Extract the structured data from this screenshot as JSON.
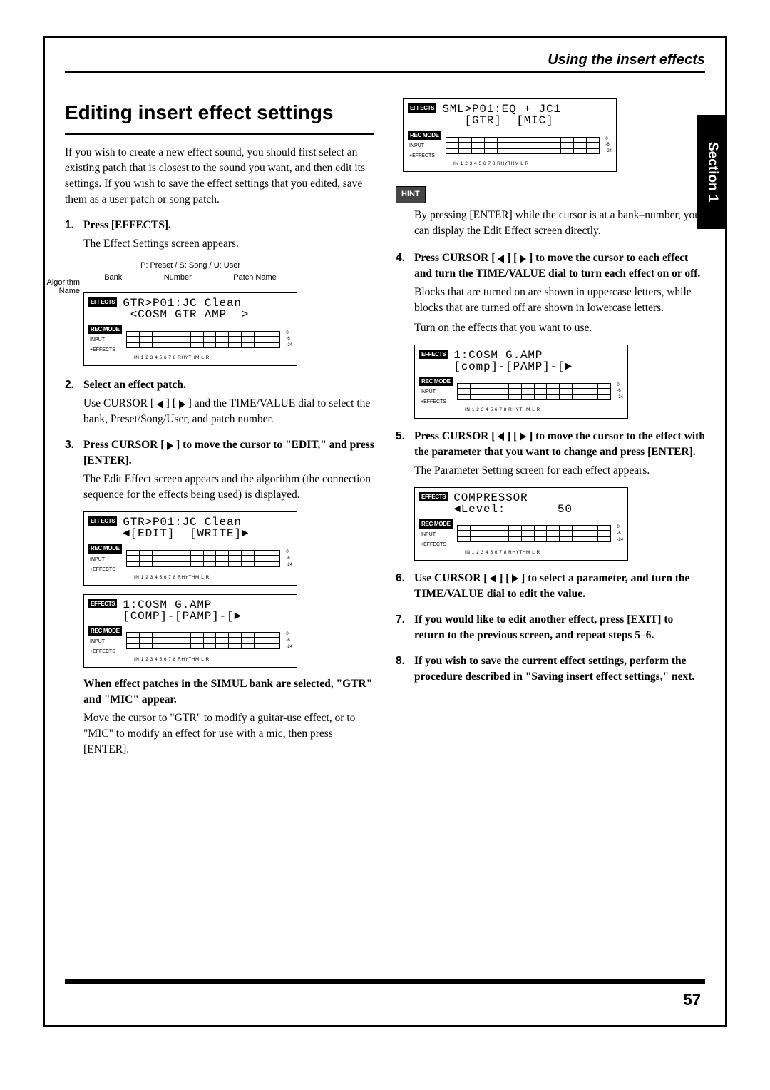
{
  "running_head": "Using the insert effects",
  "side_tab": "Section 1",
  "page_number": "57",
  "h1": "Editing insert effect settings",
  "intro": "If you wish to create a new effect sound, you should first select an existing patch that is closest to the sound you want, and then edit its settings. If you wish to save the effect settings that you edited, save them as a user patch or song patch.",
  "step1": {
    "num": "1.",
    "head": "Press [EFFECTS].",
    "body": "The Effect Settings screen appears."
  },
  "annot": {
    "topline": "P: Preset / S: Song / U: User",
    "algorithm": "Algorithm\nName",
    "bank": "Bank",
    "number": "Number",
    "patch": "Patch Name"
  },
  "lcd1": {
    "line1": "GTR>P01:JC Clean",
    "line2": " <COSM GTR AMP  >",
    "effects": "EFFECTS",
    "recmode": "REC MODE",
    "input": "INPUT",
    "plus": "+EFFECTS",
    "scale0": "0",
    "scale6": "-6",
    "scale24": "-24",
    "footer": "IN      1  2  3  4  5  6  7  8  RHYTHM      L   R"
  },
  "step2": {
    "num": "2.",
    "head": "Select an effect patch.",
    "body": "Use CURSOR [ ◁ ] [ ▷ ] and the TIME/VALUE dial to select the bank, Preset/Song/User, and patch number."
  },
  "step3": {
    "num": "3.",
    "head": "Press CURSOR [ ▷ ] to move the cursor to \"EDIT,\" and press [ENTER].",
    "body": "The Edit Effect screen appears and the algorithm (the connection sequence for the effects being used) is displayed."
  },
  "lcd2": {
    "line1": "GTR>P01:JC Clean",
    "line2": "◄[EDIT]  [WRITE]►"
  },
  "lcd3": {
    "line1": "1:COSM G.AMP",
    "line2": "[COMP]-[PAMP]-[►"
  },
  "simul_head": "When effect patches in the SIMUL bank are selected, \"GTR\" and \"MIC\" appear.",
  "simul_body": "Move the cursor to \"GTR\" to modify a guitar-use effect, or to \"MIC\" to modify an effect for use with a mic, then press [ENTER].",
  "lcd4": {
    "line1": "SML>P01:EQ + JC1",
    "line2": "   [GTR]  [MIC]"
  },
  "hint_label": "HINT",
  "hint_text": "By pressing [ENTER] while the cursor is at a bank–number, you can display the Edit Effect screen directly.",
  "step4": {
    "num": "4.",
    "head": "Press CURSOR [ ◁ ] [ ▷ ] to move the cursor to each effect and turn the TIME/VALUE dial to turn each effect on or off.",
    "body1": "Blocks that are turned on are shown in uppercase letters, while blocks that are turned off are shown in lowercase letters.",
    "body2": "Turn on the effects that you want to use."
  },
  "lcd5": {
    "line1": "1:COSM G.AMP",
    "line2": "[comp]-[PAMP]-[►"
  },
  "step5": {
    "num": "5.",
    "head": "Press CURSOR [ ◁ ] [ ▷ ] to move the cursor to the effect with the parameter that you want to change and press [ENTER].",
    "body": "The Parameter Setting screen for each effect appears."
  },
  "lcd6": {
    "line1": "COMPRESSOR",
    "line2": "◄Level:       50"
  },
  "step6": {
    "num": "6.",
    "head": "Use CURSOR [ ◁ ] [ ▷ ] to select a parameter, and turn the TIME/VALUE dial to edit the value."
  },
  "step7": {
    "num": "7.",
    "head": "If you would like to edit another effect, press [EXIT] to return to the previous screen, and repeat steps 5–6."
  },
  "step8": {
    "num": "8.",
    "head": "If you wish to save the current effect settings, perform the procedure described in \"Saving insert effect settings,\" next."
  }
}
